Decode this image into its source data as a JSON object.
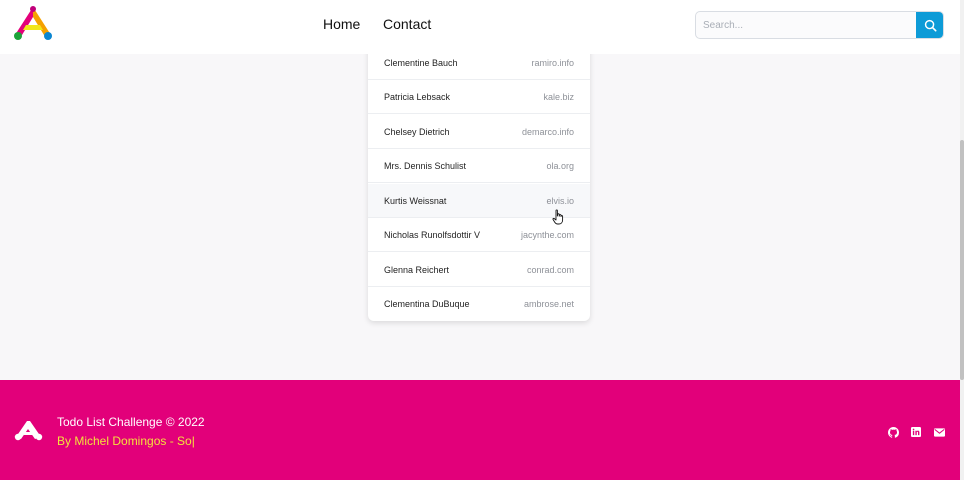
{
  "nav": {
    "home_label": "Home",
    "contact_label": "Contact"
  },
  "search": {
    "placeholder": "Search..."
  },
  "contacts": [
    {
      "name": "Clementine Bauch",
      "website": "ramiro.info"
    },
    {
      "name": "Patricia Lebsack",
      "website": "kale.biz"
    },
    {
      "name": "Chelsey Dietrich",
      "website": "demarco.info"
    },
    {
      "name": "Mrs. Dennis Schulist",
      "website": "ola.org"
    },
    {
      "name": "Kurtis Weissnat",
      "website": "elvis.io"
    },
    {
      "name": "Nicholas Runolfsdottir V",
      "website": "jacynthe.com"
    },
    {
      "name": "Glenna Reichert",
      "website": "conrad.com"
    },
    {
      "name": "Clementina DuBuque",
      "website": "ambrose.net"
    }
  ],
  "footer": {
    "title": "Todo List Challenge © 2022",
    "author": "By Michel Domingos - So|"
  },
  "icons": {
    "logo": "logo-icon",
    "search": "search-icon",
    "github": "github-icon",
    "linkedin": "linkedin-icon",
    "mail": "mail-icon"
  },
  "colors": {
    "footer_bg": "#e2007a",
    "search_button": "#0d9bd7",
    "author_text": "#f3e13c"
  }
}
